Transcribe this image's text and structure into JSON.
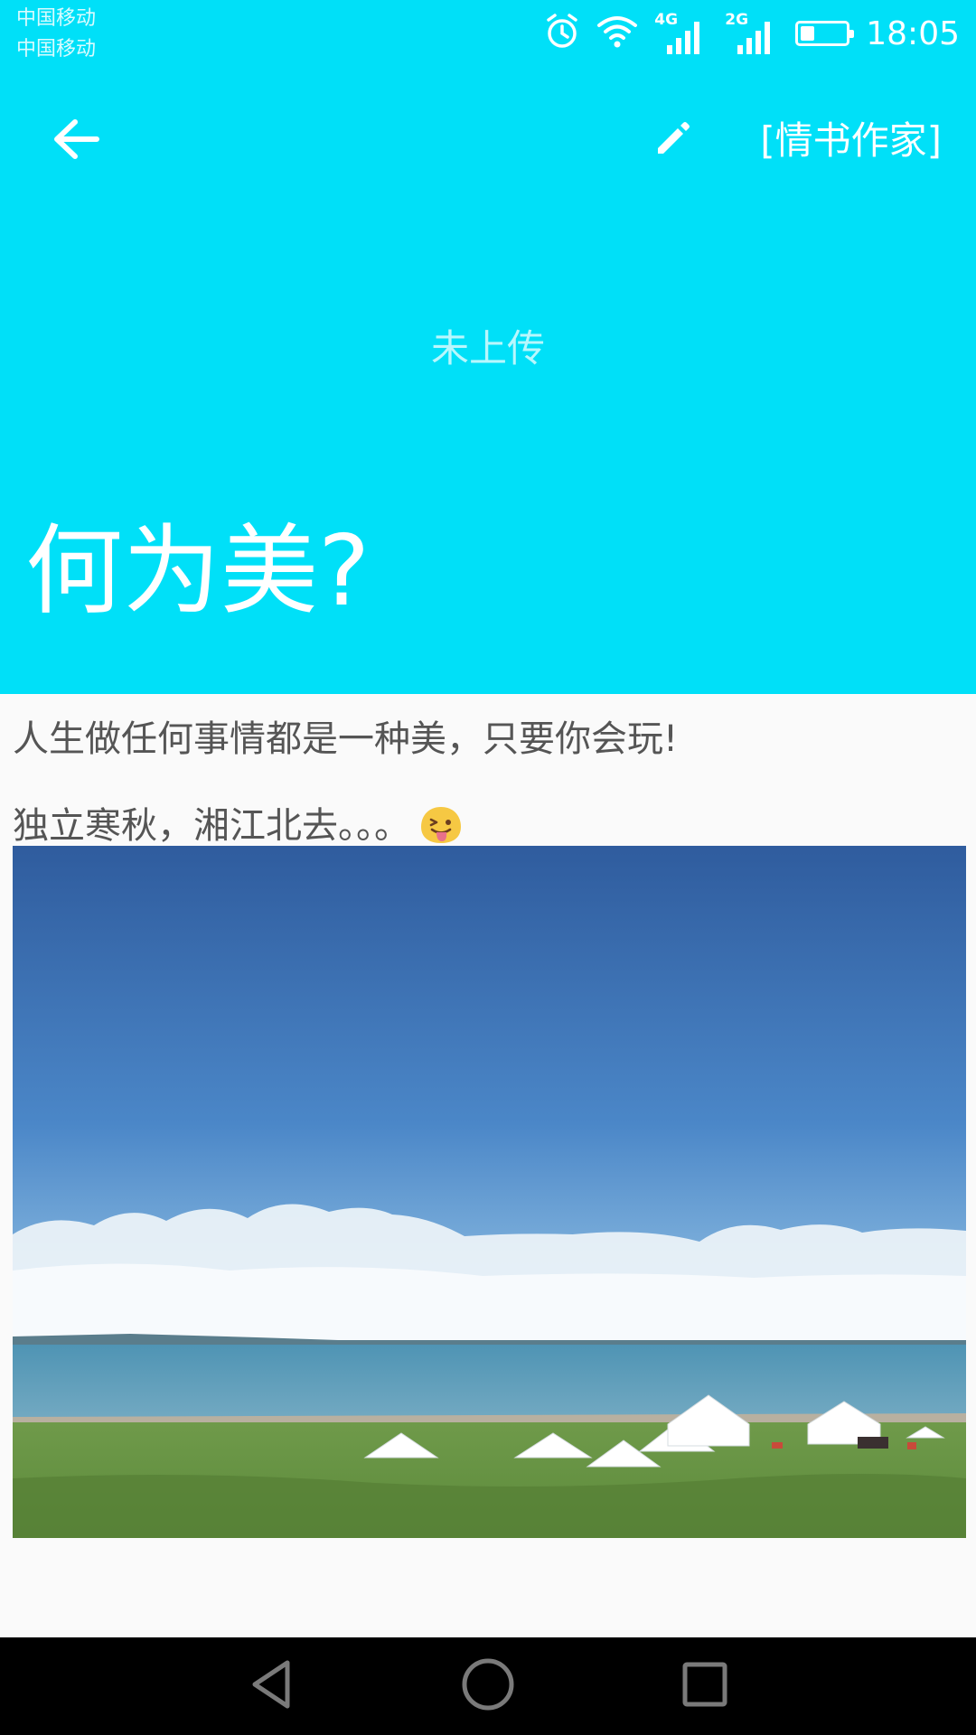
{
  "status_bar": {
    "carrier_1": "中国移动",
    "carrier_2": "中国移动",
    "network_1": "4G",
    "network_2": "2G",
    "time": "18:05",
    "battery_level": 0.3
  },
  "toolbar": {
    "back_icon": "arrow-left-icon",
    "edit_icon": "pencil-icon",
    "author_label": "[情书作家]"
  },
  "header": {
    "background_color": "#00e0f8",
    "upload_status": "未上传",
    "title": "何为美?"
  },
  "article": {
    "paragraph_1": "人生做任何事情都是一种美，只要你会玩!",
    "paragraph_2": "独立寒秋，湘江北去。。。",
    "emoji": "tongue-out-emoji"
  },
  "nav_bar": {
    "back_icon": "triangle-back-icon",
    "home_icon": "circle-home-icon",
    "recent_icon": "square-recents-icon"
  }
}
